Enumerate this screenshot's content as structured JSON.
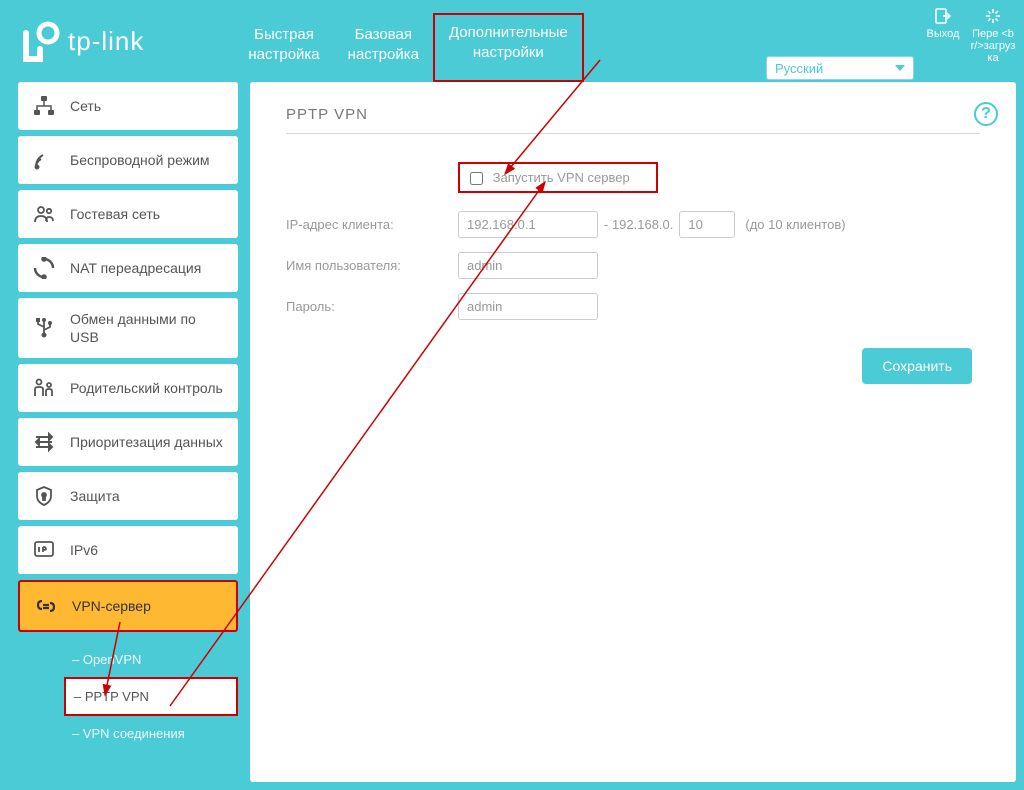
{
  "brand": "tp-link",
  "header": {
    "tabs": [
      {
        "label": "Быстрая\nнастройка"
      },
      {
        "label": "Базовая\nнастройка"
      },
      {
        "label": "Дополнительные\nнастройки"
      }
    ],
    "language": "Русский",
    "logout_label": "Выход",
    "reboot_label": "Пере <br/>загрузка"
  },
  "sidebar": {
    "items": [
      {
        "label": "Сеть",
        "icon": "network"
      },
      {
        "label": "Беспроводной режим",
        "icon": "wireless"
      },
      {
        "label": "Гостевая сеть",
        "icon": "guest"
      },
      {
        "label": "NAT переадресация",
        "icon": "nat"
      },
      {
        "label": "Обмен данными по USB",
        "icon": "usb"
      },
      {
        "label": "Родительский контроль",
        "icon": "parental"
      },
      {
        "label": "Приоритезация данных",
        "icon": "qos"
      },
      {
        "label": "Защита",
        "icon": "shield"
      },
      {
        "label": "IPv6",
        "icon": "ipv6"
      },
      {
        "label": "VPN-сервер",
        "icon": "vpn"
      }
    ],
    "submenu": [
      {
        "label": "OpenVPN"
      },
      {
        "label": "PPTP VPN"
      },
      {
        "label": "VPN соединения"
      }
    ]
  },
  "content": {
    "title": "PPTP VPN",
    "enable_label": "Запустить VPN сервер",
    "ip_label": "IP-адрес клиента:",
    "ip_start": "192.168.0.1",
    "ip_prefix": "- 192.168.0.",
    "ip_end": "10",
    "ip_hint": "(до 10 клиентов)",
    "username_label": "Имя пользователя:",
    "username_value": "admin",
    "password_label": "Пароль:",
    "password_value": "admin",
    "save_label": "Сохранить"
  }
}
